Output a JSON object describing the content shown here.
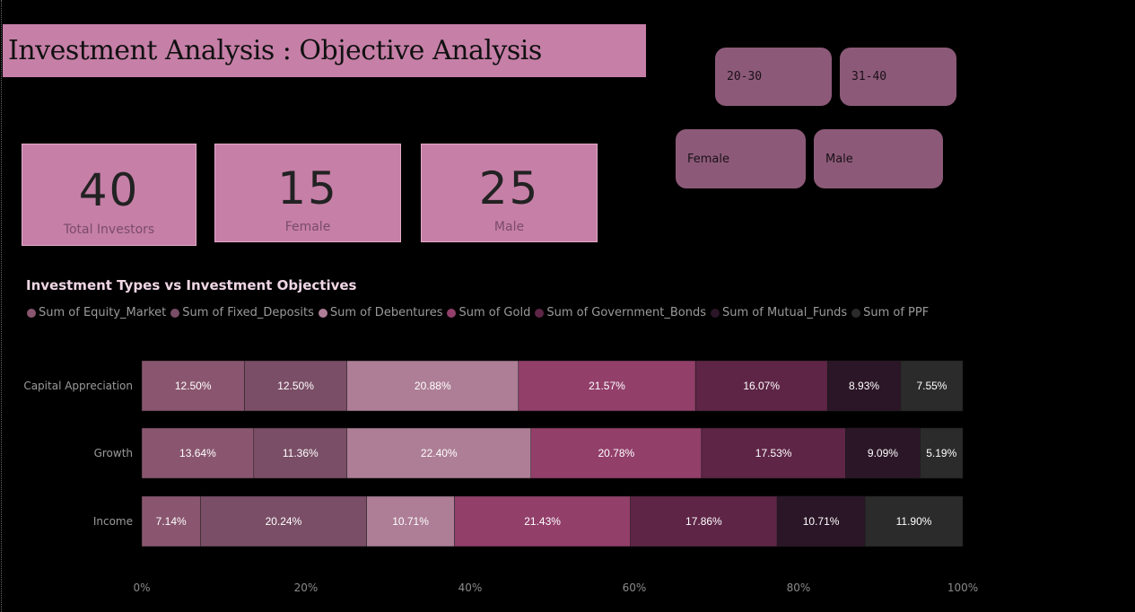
{
  "header": {
    "title": "Investment Analysis : Objective Analysis"
  },
  "slicers": {
    "age": [
      "20-30",
      "31-40"
    ],
    "gender": [
      "Female",
      "Male"
    ]
  },
  "cards": [
    {
      "value": "40",
      "label": "Total Investors"
    },
    {
      "value": "15",
      "label": "Female"
    },
    {
      "value": "25",
      "label": "Male"
    }
  ],
  "colors": {
    "background": "#000000",
    "accent": "#c67fa7",
    "slicer": "#8c5a78"
  },
  "chart_data": {
    "type": "bar",
    "orientation": "horizontal",
    "stacked": "100%",
    "title": "Investment Types vs Investment Objectives",
    "categories": [
      "Capital Appreciation",
      "Growth",
      "Income"
    ],
    "series": [
      {
        "name": "Sum of Equity_Market",
        "color": "#8a566f",
        "values": [
          12.5,
          13.64,
          7.14
        ],
        "labels": [
          "12.50%",
          "13.64%",
          "7.14%"
        ]
      },
      {
        "name": "Sum of Fixed_Deposits",
        "color": "#7a4e66",
        "values": [
          12.5,
          11.36,
          20.24
        ],
        "labels": [
          "12.50%",
          "11.36%",
          "20.24%"
        ]
      },
      {
        "name": "Sum of Debentures",
        "color": "#ad7e96",
        "values": [
          20.88,
          22.4,
          10.71
        ],
        "labels": [
          "20.88%",
          "22.40%",
          "10.71%"
        ]
      },
      {
        "name": "Sum of Gold",
        "color": "#923f6a",
        "values": [
          21.57,
          20.78,
          21.43
        ],
        "labels": [
          "21.57%",
          "20.78%",
          "21.43%"
        ]
      },
      {
        "name": "Sum of Government_Bonds",
        "color": "#5e2546",
        "values": [
          16.07,
          17.53,
          17.86
        ],
        "labels": [
          "16.07%",
          "17.53%",
          "17.86%"
        ]
      },
      {
        "name": "Sum of Mutual_Funds",
        "color": "#2b1627",
        "values": [
          8.93,
          9.09,
          10.71
        ],
        "labels": [
          "8.93%",
          "9.09%",
          "10.71%"
        ]
      },
      {
        "name": "Sum of PPF",
        "color": "#2b2b2b",
        "values": [
          7.55,
          5.19,
          11.9
        ],
        "labels": [
          "7.55%",
          "5.19%",
          "11.90%"
        ]
      }
    ],
    "x_ticks": [
      "0%",
      "20%",
      "40%",
      "60%",
      "80%",
      "100%"
    ],
    "xlim": [
      0,
      100
    ],
    "legend_position": "top-left",
    "grid": false
  }
}
